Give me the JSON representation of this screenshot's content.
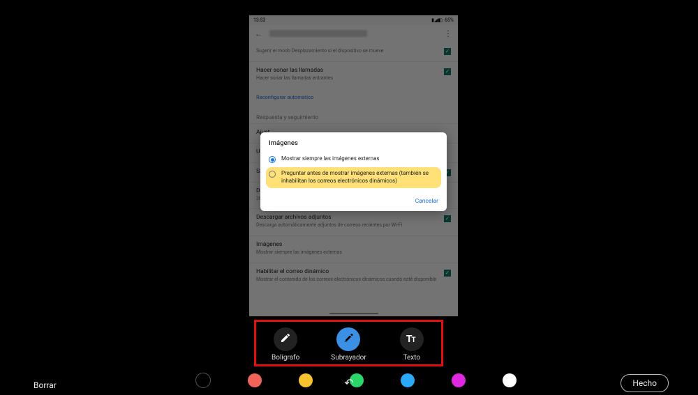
{
  "statusbar": {
    "time": "13:53",
    "battery": "65%"
  },
  "appbar": {
    "menu_icon": "⋮"
  },
  "settings": {
    "rows": [
      {
        "title": "",
        "sub": "Sugerir el modo Desplazamiento si el dispositivo se mueve",
        "check": true
      },
      {
        "title": "Hacer sonar las llamadas",
        "sub": "Hacer sonar las llamadas entrantes",
        "check": true
      },
      {
        "link": "Reconfigurar automático"
      }
    ],
    "section1": "Respuesta y seguimiento",
    "rows2": [
      {
        "title": "Ajust"
      },
      {
        "title": "Uso d"
      },
      {
        "title": "Sincr",
        "check": true
      },
      {
        "title": "Días de correo sincronizados",
        "sub": "30 días"
      },
      {
        "title": "Descargar archivos adjuntos",
        "sub": "Descarga automáticamente adjuntos de correos recientes por Wi-Fi",
        "check": true
      },
      {
        "title": "Imágenes",
        "sub": "Mostrar siempre las imágenes externas"
      },
      {
        "title": "Habilitar el correo dinámico",
        "sub": "Mostrar el contenido de los correos electrónicos dinámicos cuando esté disponible",
        "check": true
      }
    ]
  },
  "dialog": {
    "title": "Imágenes",
    "opt1": "Mostrar siempre las imágenes externas",
    "opt2": "Preguntar antes de mostrar imágenes externas (también se inhabilitan los correos electrónicos dinámicos)",
    "cancel": "Cancelar"
  },
  "tools": {
    "pen": "Bolígrafo",
    "highlighter": "Subrayador",
    "text": "Texto"
  },
  "palette": {
    "colors": [
      "#000000",
      "#f2645a",
      "#f7c430",
      "#2bd66b",
      "#2ba8f7",
      "#e028e0",
      "#ffffff"
    ]
  },
  "bottombar": {
    "erase": "Borrar",
    "undo_icon": "↶",
    "done": "Hecho"
  }
}
